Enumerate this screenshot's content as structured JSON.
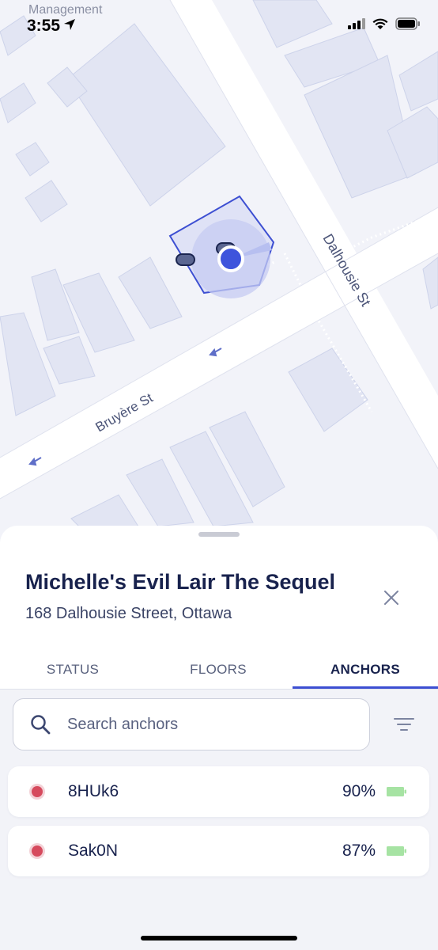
{
  "status_bar": {
    "back_app": "Management",
    "time": "3:55"
  },
  "map": {
    "streets": [
      "Dalhousie St",
      "Bruyère St"
    ]
  },
  "sheet": {
    "title": "Michelle's Evil Lair The Sequel",
    "address": "168 Dalhousie Street, Ottawa",
    "tabs": [
      {
        "label": "STATUS",
        "active": false
      },
      {
        "label": "FLOORS",
        "active": false
      },
      {
        "label": "ANCHORS",
        "active": true
      }
    ],
    "search": {
      "placeholder": "Search anchors",
      "value": ""
    },
    "anchors": [
      {
        "name": "8HUk6",
        "battery": "90%",
        "status_color": "#d64a5d"
      },
      {
        "name": "Sak0N",
        "battery": "87%",
        "status_color": "#d64a5d"
      }
    ]
  },
  "colors": {
    "accent": "#3d4fd2",
    "text": "#18224d",
    "offline": "#d64a5d",
    "battery": "#a6e3a3"
  }
}
